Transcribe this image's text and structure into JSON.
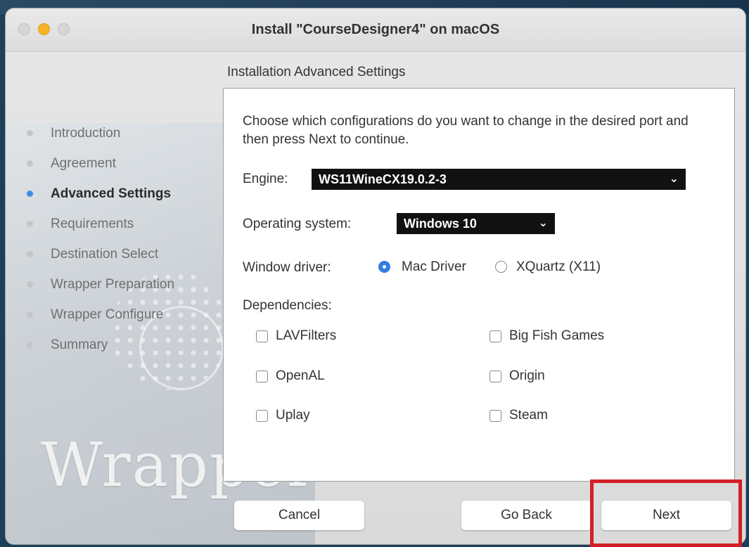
{
  "window": {
    "title": "Install \"CourseDesigner4\" on macOS",
    "section_title": "Installation Advanced Settings"
  },
  "steps": [
    {
      "label": "Introduction",
      "active": false
    },
    {
      "label": "Agreement",
      "active": false
    },
    {
      "label": "Advanced Settings",
      "active": true
    },
    {
      "label": "Requirements",
      "active": false
    },
    {
      "label": "Destination Select",
      "active": false
    },
    {
      "label": "Wrapper Preparation",
      "active": false
    },
    {
      "label": "Wrapper Configure",
      "active": false
    },
    {
      "label": "Summary",
      "active": false
    }
  ],
  "panel": {
    "description": "Choose which configurations do you want to change in the desired port and then press Next to continue.",
    "engine_label": "Engine:",
    "engine_value": "WS11WineCX19.0.2-3",
    "os_label": "Operating system:",
    "os_value": "Windows 10",
    "driver_label": "Window driver:",
    "driver_options": [
      {
        "label": "Mac Driver",
        "selected": true
      },
      {
        "label": "XQuartz (X11)",
        "selected": false
      }
    ],
    "dependencies_label": "Dependencies:",
    "dependencies": [
      {
        "label": "LAVFilters",
        "checked": false
      },
      {
        "label": "Big Fish Games",
        "checked": false
      },
      {
        "label": "OpenAL",
        "checked": false
      },
      {
        "label": "Origin",
        "checked": false
      },
      {
        "label": "Uplay",
        "checked": false
      },
      {
        "label": "Steam",
        "checked": false
      }
    ]
  },
  "buttons": {
    "cancel": "Cancel",
    "back": "Go Back",
    "next": "Next"
  },
  "branding": {
    "logo_text": "Wrapper"
  },
  "colors": {
    "accent": "#3b8ee3",
    "highlight": "#d41f26",
    "select_bg": "#111111"
  }
}
